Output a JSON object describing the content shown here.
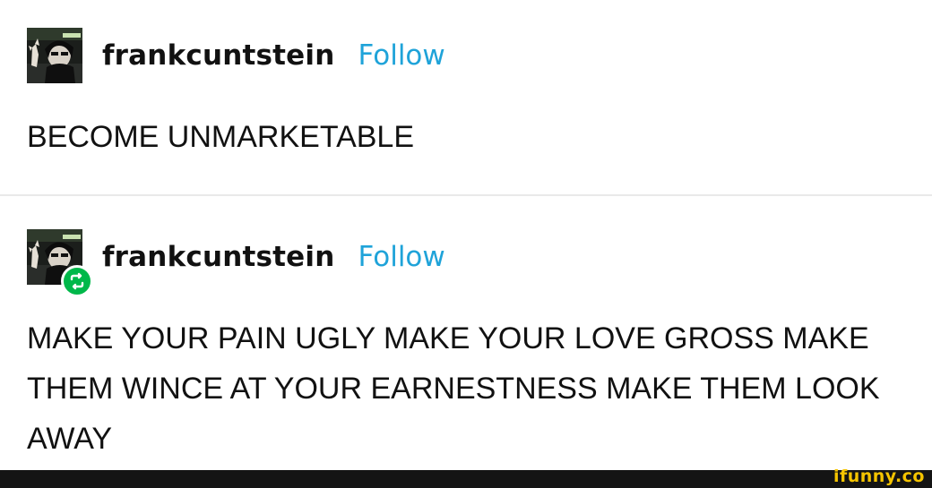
{
  "posts": [
    {
      "username": "frankcuntstein",
      "follow_label": "Follow",
      "reblogged": false,
      "text": "BECOME UNMARKETABLE"
    },
    {
      "username": "frankcuntstein",
      "follow_label": "Follow",
      "reblogged": true,
      "text": "MAKE YOUR PAIN UGLY MAKE YOUR LOVE GROSS MAKE THEM WINCE AT YOUR EARNESTNESS MAKE THEM LOOK AWAY"
    }
  ],
  "watermark": {
    "text": "ifunny.co"
  },
  "icons": {
    "avatar": "avatar-icon",
    "reblog": "reblog-icon"
  },
  "colors": {
    "follow": "#1fa3d9",
    "reblog_badge": "#00b84a",
    "watermark": "#f5c400",
    "footer": "#141414"
  }
}
